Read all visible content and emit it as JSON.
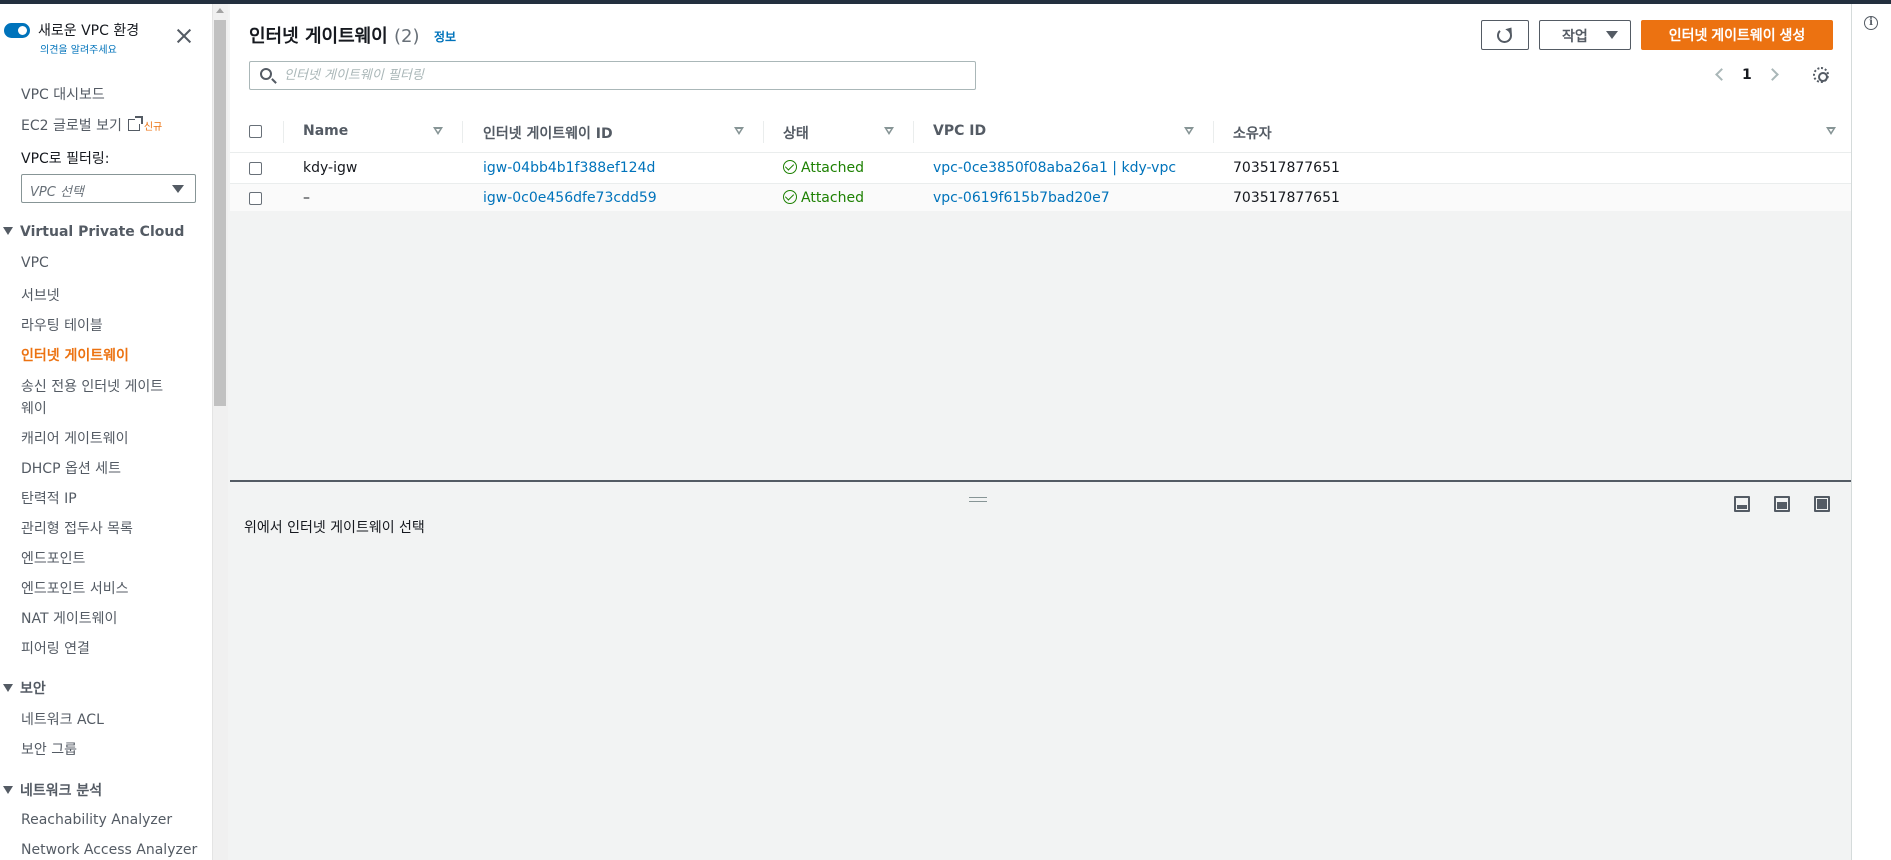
{
  "sidebar": {
    "new_vpc_title": "새로운 VPC 환경",
    "feedback_link": "의견을 알려주세요",
    "items_top": [
      {
        "label": "VPC 대시보드"
      },
      {
        "label": "EC2 글로벌 보기",
        "badge": "신규"
      }
    ],
    "filter_label": "VPC로 필터링:",
    "filter_select": "VPC 선택",
    "sections": [
      {
        "title": "Virtual Private Cloud",
        "items": [
          "VPC",
          "서브넷",
          "라우팅 테이블",
          "인터넷 게이트웨이",
          "송신 전용 인터넷 게이트",
          "웨이",
          "캐리어 게이트웨이",
          "DHCP 옵션 세트",
          "탄력적 IP",
          "관리형 접두사 목록",
          "엔드포인트",
          "엔드포인트 서비스",
          "NAT 게이트웨이",
          "피어링 연결"
        ]
      },
      {
        "title": "보안",
        "items": [
          "네트워크 ACL",
          "보안 그룹"
        ]
      },
      {
        "title": "네트워크 분석",
        "items": [
          "Reachability Analyzer",
          "Network Access Analyzer"
        ]
      }
    ],
    "active_item": "인터넷 게이트웨이"
  },
  "header": {
    "title": "인터넷 게이트웨이",
    "count": "(2)",
    "info": "정보",
    "actions_label": "작업",
    "create_label": "인터넷 게이트웨이 생성"
  },
  "search": {
    "placeholder": "인터넷 게이트웨이 필터링"
  },
  "pager": {
    "page": "1"
  },
  "table": {
    "columns": [
      "Name",
      "인터넷 게이트웨이 ID",
      "상태",
      "VPC ID",
      "소유자"
    ],
    "rows": [
      {
        "name": "kdy-igw",
        "id": "igw-04bb4b1f388ef124d",
        "state": "Attached",
        "vpc": "vpc-0ce3850f08aba26a1 | kdy-vpc",
        "owner": "703517877651"
      },
      {
        "name": "–",
        "id": "igw-0c0e456dfe73cdd59",
        "state": "Attached",
        "vpc": "vpc-0619f615b7bad20e7",
        "owner": "703517877651"
      }
    ]
  },
  "detail": {
    "empty_text": "위에서 인터넷 게이트웨이 선택"
  },
  "colors": {
    "accent": "#ec7211",
    "link": "#0073bb",
    "success": "#1d8102",
    "nav_dark": "#232f3e"
  },
  "icons": [
    "toggle-icon",
    "close-icon",
    "external-link-icon",
    "refresh-icon",
    "search-icon",
    "gear-icon",
    "check-circle-icon",
    "info-icon"
  ]
}
